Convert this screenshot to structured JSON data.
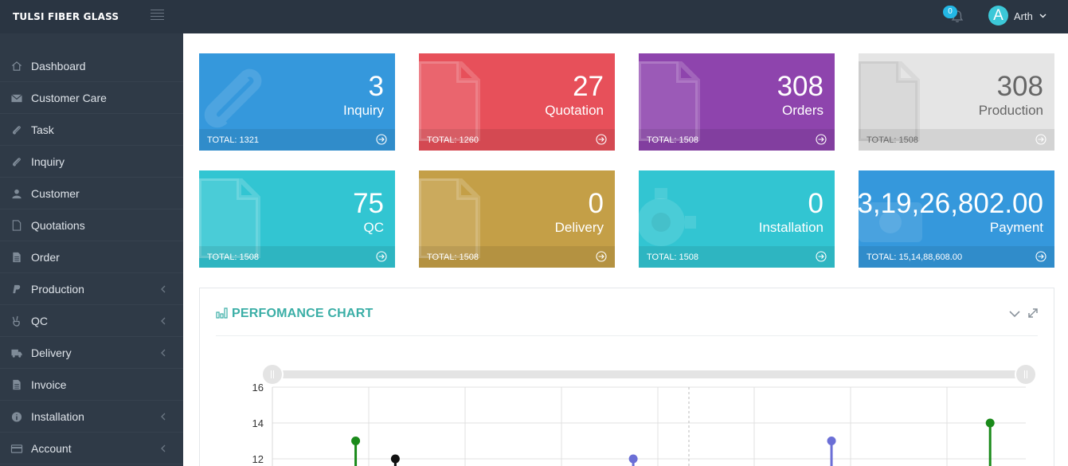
{
  "header": {
    "brand": "TULSI FIBER GLASS",
    "notification_count": "0",
    "avatar_letter": "A",
    "username": "Arth"
  },
  "sidebar": {
    "items": [
      {
        "label": "Dashboard",
        "icon": "home-icon",
        "submenu": false
      },
      {
        "label": "Customer Care",
        "icon": "envelope-icon",
        "submenu": false
      },
      {
        "label": "Task",
        "icon": "paperclip-icon",
        "submenu": false
      },
      {
        "label": "Inquiry",
        "icon": "paperclip-icon",
        "submenu": false
      },
      {
        "label": "Customer",
        "icon": "user-icon",
        "submenu": false
      },
      {
        "label": "Quotations",
        "icon": "file-outline-icon",
        "submenu": false
      },
      {
        "label": "Order",
        "icon": "file-text-icon",
        "submenu": false
      },
      {
        "label": "Production",
        "icon": "paypal-icon",
        "submenu": true
      },
      {
        "label": "QC",
        "icon": "peace-hand-icon",
        "submenu": true
      },
      {
        "label": "Delivery",
        "icon": "truck-icon",
        "submenu": true
      },
      {
        "label": "Invoice",
        "icon": "file-text-icon",
        "submenu": false
      },
      {
        "label": "Installation",
        "icon": "info-circle-icon",
        "submenu": true
      },
      {
        "label": "Account",
        "icon": "credit-card-icon",
        "submenu": true
      }
    ]
  },
  "cards": [
    {
      "value": "3",
      "label": "Inquiry",
      "total": "TOTAL: 1321",
      "color": "#3598dc",
      "icon": "paperclip-icon"
    },
    {
      "value": "27",
      "label": "Quotation",
      "total": "TOTAL: 1260",
      "color": "#e7505a",
      "icon": "file-icon"
    },
    {
      "value": "308",
      "label": "Orders",
      "total": "TOTAL: 1508",
      "color": "#8e44ad",
      "icon": "file-icon"
    },
    {
      "value": "308",
      "label": "Production",
      "total": "TOTAL: 1508",
      "color": "#e5e5e5",
      "icon": "file-icon"
    },
    {
      "value": "75",
      "label": "QC",
      "total": "TOTAL: 1508",
      "color": "#32c5d2",
      "icon": "file-icon"
    },
    {
      "value": "0",
      "label": "Delivery",
      "total": "TOTAL: 1508",
      "color": "#c49f47",
      "icon": "file-icon"
    },
    {
      "value": "0",
      "label": "Installation",
      "total": "TOTAL: 1508",
      "color": "#32c5d2",
      "icon": "gear-icon"
    },
    {
      "value": "3,19,26,802.00",
      "label": "Payment",
      "total": "TOTAL: 15,14,88,608.00",
      "color": "#3598dc",
      "icon": "money-icon"
    }
  ],
  "panel": {
    "title": "PERFOMANCE CHART"
  },
  "chart_data": {
    "type": "scatter",
    "y_ticks": [
      "16",
      "14",
      "12"
    ],
    "ylim": [
      12,
      16
    ],
    "grid": true,
    "series": [
      {
        "color": "#1a8a1a",
        "points": [
          {
            "x": 1,
            "y": 13
          },
          {
            "x": 9,
            "y": 14
          }
        ]
      },
      {
        "color": "#111111",
        "points": [
          {
            "x": 1.5,
            "y": 12
          }
        ]
      },
      {
        "color": "#6b6fd6",
        "points": [
          {
            "x": 4.5,
            "y": 12
          },
          {
            "x": 7,
            "y": 13
          }
        ]
      }
    ]
  }
}
